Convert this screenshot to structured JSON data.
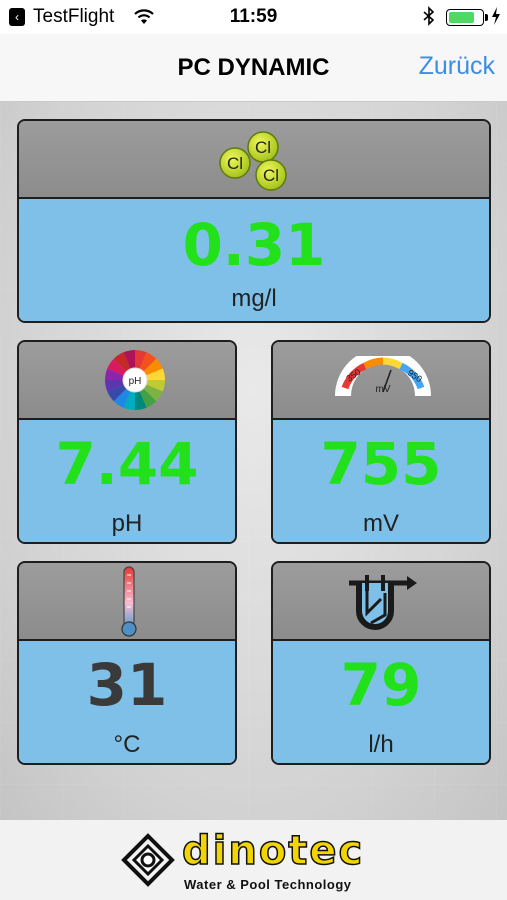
{
  "status_bar": {
    "back_app_glyph": "‹",
    "carrier": "TestFlight",
    "time": "11:59",
    "battery_level": 0.78,
    "battery_color": "#4cd964",
    "icons": [
      "back-to-app-icon",
      "wifi-icon",
      "bluetooth-icon",
      "battery-icon",
      "charging-icon"
    ]
  },
  "navbar": {
    "title": "PC DYNAMIC",
    "back_label": "Zurück",
    "back_color": "#3a8ee6"
  },
  "cards": {
    "chlorine": {
      "icon": "chlorine-icon",
      "icon_labels": [
        "Cl",
        "Cl",
        "Cl"
      ],
      "value": "0.31",
      "unit": "mg/l"
    },
    "ph": {
      "icon": "ph-color-wheel-icon",
      "icon_label": "pH",
      "value": "7.44",
      "unit": "pH"
    },
    "mv": {
      "icon": "redox-gauge-icon",
      "gauge_min": "350",
      "gauge_unit": "mV",
      "gauge_max": "950",
      "value": "755",
      "unit": "mV"
    },
    "temperature": {
      "icon": "thermometer-icon",
      "value": "31",
      "unit": "°C"
    },
    "flow": {
      "icon": "flow-cell-icon",
      "value": "79",
      "unit": "l/h"
    }
  },
  "colors": {
    "value_green": "#22e11b",
    "value_gray": "#3a3a3a",
    "card_body": "#7ec0e8",
    "card_head": "#949494",
    "brand_yellow": "#f2d400"
  },
  "footer": {
    "brand": "dinotec",
    "tagline": "Water & Pool Technology",
    "logo_icon": "dinotec-logo-icon"
  }
}
